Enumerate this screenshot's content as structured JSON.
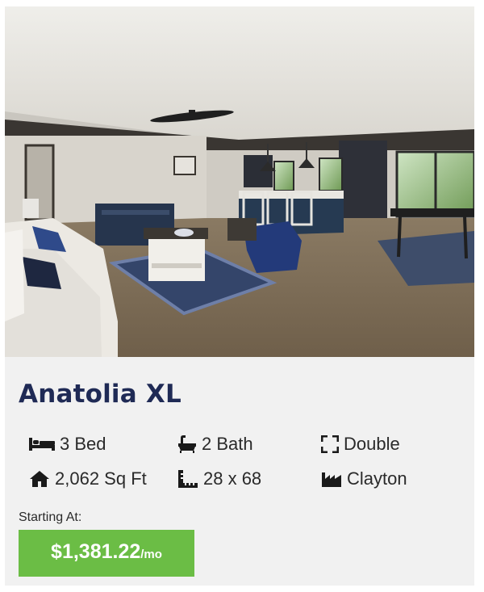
{
  "listing": {
    "name": "Anatolia XL",
    "photo_subject": "living-room-kitchen-interior",
    "specs": [
      {
        "icon": "bed-icon",
        "text": "3 Bed"
      },
      {
        "icon": "bath-icon",
        "text": "2 Bath"
      },
      {
        "icon": "expand-icon",
        "text": "Double"
      },
      {
        "icon": "home-icon",
        "text": "2,062 Sq Ft"
      },
      {
        "icon": "ruler-icon",
        "text": "28 x 68"
      },
      {
        "icon": "factory-icon",
        "text": "Clayton"
      }
    ],
    "price_label": "Starting At:",
    "price": "$1,381.22",
    "price_unit": "/mo",
    "colors": {
      "title": "#1f2a55",
      "price_button": "#6bbd45",
      "card_background": "#f1f1f1"
    }
  }
}
